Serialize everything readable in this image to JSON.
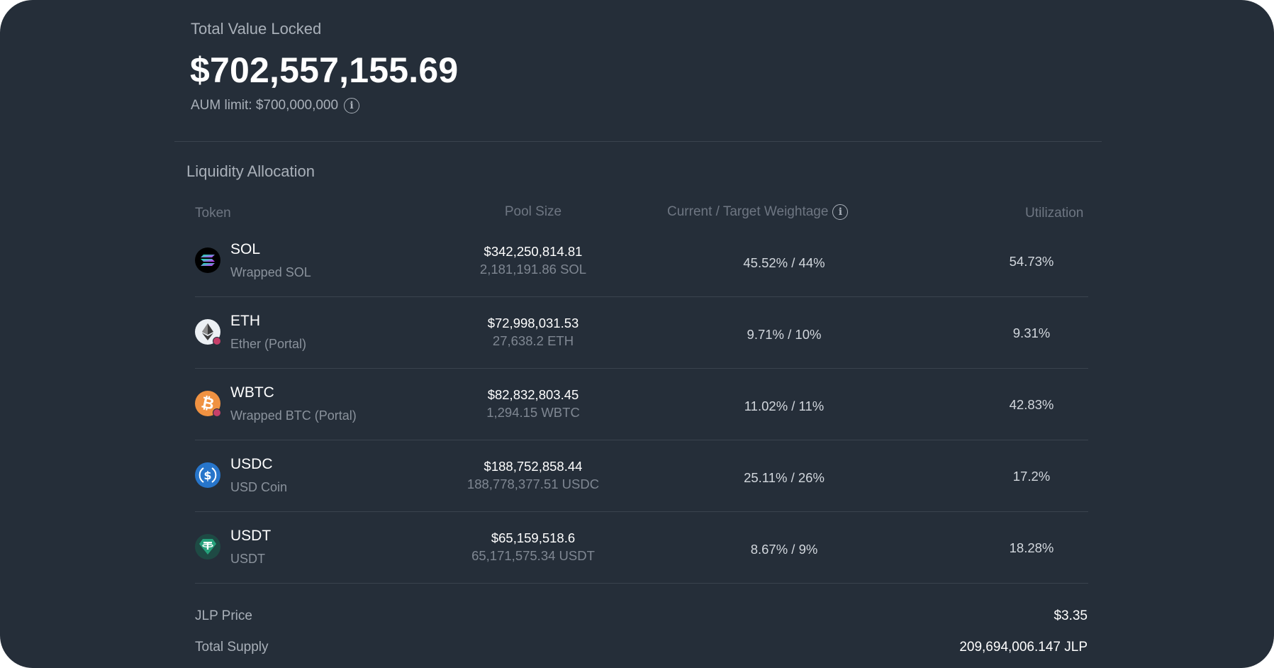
{
  "tvl": {
    "label": "Total Value Locked",
    "value": "$702,557,155.69",
    "aum_limit": "AUM limit: $700,000,000"
  },
  "allocation": {
    "title": "Liquidity Allocation",
    "headers": {
      "token": "Token",
      "pool_size": "Pool Size",
      "weightage": "Current / Target Weightage",
      "utilization": "Utilization"
    },
    "rows": [
      {
        "symbol": "SOL",
        "name": "Wrapped SOL",
        "pool_usd": "$342,250,814.81",
        "pool_amount": "2,181,191.86 SOL",
        "weightage": "45.52% / 44%",
        "utilization": "54.73%",
        "icon": "sol-icon",
        "color": "#000000"
      },
      {
        "symbol": "ETH",
        "name": "Ether (Portal)",
        "pool_usd": "$72,998,031.53",
        "pool_amount": "27,638.2 ETH",
        "weightage": "9.71% / 10%",
        "utilization": "9.31%",
        "icon": "eth-icon",
        "color": "#ecf0f4"
      },
      {
        "symbol": "WBTC",
        "name": "Wrapped BTC (Portal)",
        "pool_usd": "$82,832,803.45",
        "pool_amount": "1,294.15 WBTC",
        "weightage": "11.02% / 11%",
        "utilization": "42.83%",
        "icon": "wbtc-icon",
        "color": "#f09242"
      },
      {
        "symbol": "USDC",
        "name": "USD Coin",
        "pool_usd": "$188,752,858.44",
        "pool_amount": "188,778,377.51 USDC",
        "weightage": "25.11% / 26%",
        "utilization": "17.2%",
        "icon": "usdc-icon",
        "color": "#2775ca"
      },
      {
        "symbol": "USDT",
        "name": "USDT",
        "pool_usd": "$65,159,518.6",
        "pool_amount": "65,171,575.34 USDT",
        "weightage": "8.67% / 9%",
        "utilization": "18.28%",
        "icon": "usdt-icon",
        "color": "#1e4a44"
      }
    ]
  },
  "footer": {
    "jlp_price_label": "JLP Price",
    "jlp_price_value": "$3.35",
    "total_supply_label": "Total Supply",
    "total_supply_value": "209,694,006.147 JLP"
  }
}
